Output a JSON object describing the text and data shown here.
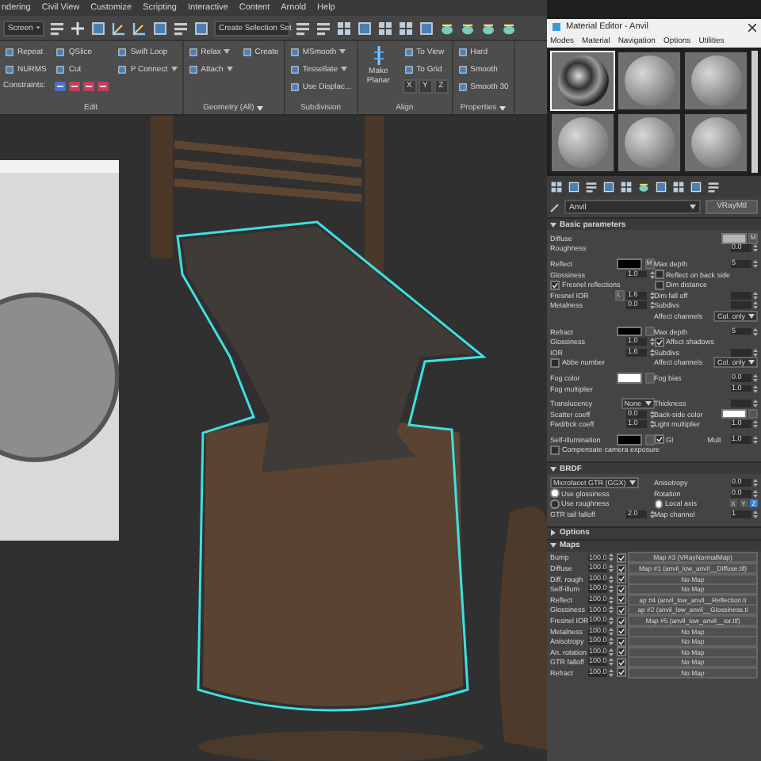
{
  "menu_bar": [
    "ndering",
    "Civil View",
    "Customize",
    "Scripting",
    "Interactive",
    "Content",
    "Arnold",
    "Help"
  ],
  "toolbar": {
    "view_dropdown": "Screen",
    "selection_set": "Create Selection Set"
  },
  "ribbon": {
    "groups": [
      {
        "title": "Edit",
        "dropdown": false,
        "columns": [
          [
            {
              "kind": "button",
              "label": "Repeat"
            },
            {
              "kind": "button",
              "label": "NURMS"
            },
            {
              "kind": "label",
              "label": "Constraints:"
            }
          ],
          [
            {
              "kind": "button",
              "label": "QSlice"
            },
            {
              "kind": "button",
              "label": "Cut"
            },
            {
              "kind": "icons"
            }
          ],
          [
            {
              "kind": "button",
              "label": "Swift Loop"
            },
            {
              "kind": "dropdown",
              "label": "P Connect"
            }
          ]
        ]
      },
      {
        "title": "Geometry (All)",
        "dropdown": true,
        "columns": [
          [
            {
              "kind": "dropdown",
              "label": "Relax"
            },
            {
              "kind": "dropdown",
              "label": "Attach"
            }
          ],
          [
            {
              "kind": "button",
              "label": "Create"
            }
          ]
        ]
      },
      {
        "title": "Subdivision",
        "dropdown": false,
        "columns": [
          [
            {
              "kind": "dropdown",
              "label": "MSmooth"
            },
            {
              "kind": "dropdown",
              "label": "Tessellate"
            },
            {
              "kind": "button",
              "label": "Use Displac..."
            }
          ]
        ]
      },
      {
        "title": "Align",
        "dropdown": false,
        "columns": [
          [
            {
              "kind": "big",
              "label": "Make Planar"
            }
          ],
          [
            {
              "kind": "button",
              "label": "To View"
            },
            {
              "kind": "button",
              "label": "To Grid"
            },
            {
              "kind": "axes",
              "labels": [
                "X",
                "Y",
                "Z"
              ]
            }
          ]
        ]
      },
      {
        "title": "Properties",
        "dropdown": true,
        "columns": [
          [
            {
              "kind": "button",
              "label": "Hard"
            },
            {
              "kind": "button",
              "label": "Smooth"
            },
            {
              "kind": "button",
              "label": "Smooth 30"
            }
          ]
        ]
      }
    ]
  },
  "material_editor": {
    "title": "Material Editor - Anvil",
    "menu": [
      "Modes",
      "Material",
      "Navigation",
      "Options",
      "Utilities"
    ],
    "slots": [
      {
        "kind": "chrome",
        "selected": true
      },
      {
        "kind": "plain",
        "selected": false
      },
      {
        "kind": "plain",
        "selected": false
      },
      {
        "kind": "plain",
        "selected": false
      },
      {
        "kind": "plain",
        "selected": false
      },
      {
        "kind": "plain",
        "selected": false
      }
    ],
    "material_name": "Anvil",
    "material_type": "VRayMtl",
    "rollouts": [
      {
        "title": "Basic parameters",
        "expanded": true,
        "sections": [
          [
            {
              "left": [
                {
                  "kind": "swatch",
                  "label": "Diffuse",
                  "color": "#b4b4b4",
                  "button": "M"
                }
              ]
            },
            {
              "left": [
                {
                  "kind": "spinner",
                  "label": "Roughness",
                  "value": "0.0"
                }
              ]
            }
          ],
          [
            {
              "left": [
                {
                  "kind": "swatch",
                  "label": "Reflect",
                  "color": "#000000",
                  "button": "M"
                }
              ],
              "right": [
                {
                  "kind": "spinner",
                  "label": "Max depth",
                  "value": "5"
                }
              ]
            },
            {
              "left": [
                {
                  "kind": "spinner",
                  "label": "Glossiness",
                  "value": "1.0"
                }
              ],
              "right": [
                {
                  "kind": "check",
                  "label": "Reflect on back side",
                  "checked": false
                }
              ]
            },
            {
              "left": [
                {
                  "kind": "check",
                  "label": "Fresnel reflections",
                  "checked": true
                }
              ],
              "right": [
                {
                  "kind": "check",
                  "label": "Dim distance",
                  "checked": false
                }
              ]
            },
            {
              "left": [
                {
                  "kind": "spinner",
                  "label": "Fresnel IOR",
                  "lock": "L",
                  "value": "1.6"
                }
              ],
              "right": [
                {
                  "kind": "spinner",
                  "label": "Dim fall off"
                }
              ]
            },
            {
              "left": [
                {
                  "kind": "spinner",
                  "label": "Metalness",
                  "value": "0.0"
                }
              ],
              "right": [
                {
                  "kind": "spinner",
                  "label": "Subdivs"
                }
              ]
            },
            {
              "right": [
                {
                  "kind": "dropdown",
                  "label": "Affect channels",
                  "value": "Col. only"
                }
              ]
            }
          ],
          [
            {
              "left": [
                {
                  "kind": "swatch",
                  "label": "Refract",
                  "color": "#000000"
                }
              ],
              "right": [
                {
                  "kind": "spinner",
                  "label": "Max depth",
                  "value": "5"
                }
              ]
            },
            {
              "left": [
                {
                  "kind": "spinner",
                  "label": "Glossiness",
                  "value": "1.0"
                }
              ],
              "right": [
                {
                  "kind": "check",
                  "label": "Affect shadows",
                  "checked": true
                }
              ]
            },
            {
              "left": [
                {
                  "kind": "spinner",
                  "label": "IOR",
                  "value": "1.6"
                }
              ],
              "right": [
                {
                  "kind": "spinner",
                  "label": "Subdivs"
                }
              ]
            },
            {
              "left": [
                {
                  "kind": "check",
                  "label": "Abbe number",
                  "checked": false
                }
              ],
              "right": [
                {
                  "kind": "dropdown",
                  "label": "Affect channels",
                  "value": "Col. only"
                }
              ]
            }
          ],
          [
            {
              "left": [
                {
                  "kind": "swatch",
                  "label": "Fog color",
                  "color": "#ffffff"
                }
              ],
              "right": [
                {
                  "kind": "spinner",
                  "label": "Fog bias",
                  "value": "0.0"
                }
              ]
            },
            {
              "left": [
                {
                  "kind": "spinner",
                  "label": "Fog multiplier",
                  "value": "1.0"
                }
              ]
            }
          ],
          [
            {
              "left": [
                {
                  "kind": "dropdown",
                  "label": "Translucency",
                  "value": "None"
                }
              ],
              "right": [
                {
                  "kind": "spinner",
                  "label": "Thickness"
                }
              ]
            },
            {
              "left": [
                {
                  "kind": "spinner",
                  "label": "Scatter coeff",
                  "value": "0.0"
                }
              ],
              "right": [
                {
                  "kind": "swatch",
                  "label": "Back-side color",
                  "color": "#ffffff"
                }
              ]
            },
            {
              "left": [
                {
                  "kind": "spinner",
                  "label": "Fwd/bck coeff",
                  "value": "1.0"
                }
              ],
              "right": [
                {
                  "kind": "spinner",
                  "label": "Light multiplier",
                  "value": "1.0"
                }
              ]
            }
          ],
          [
            {
              "left": [
                {
                  "kind": "swatch",
                  "label": "Self-illumination",
                  "color": "#000000"
                }
              ],
              "right": [
                {
                  "kind": "check",
                  "label": "GI",
                  "checked": true
                },
                {
                  "kind": "spinner",
                  "label": "Mult",
                  "value": "1.0"
                }
              ]
            },
            {
              "left": [
                {
                  "kind": "check",
                  "label": "Compensate camera exposure",
                  "checked": false
                }
              ]
            }
          ]
        ]
      },
      {
        "title": "BRDF",
        "expanded": true,
        "sections": [
          [
            {
              "left": [
                {
                  "kind": "dropdown",
                  "value": "Microfacet GTR (GGX)"
                }
              ],
              "right": [
                {
                  "kind": "spinner",
                  "label": "Anisotropy",
                  "value": "0.0"
                }
              ]
            },
            {
              "left": [
                {
                  "kind": "radio",
                  "label": "Use glossiness",
                  "selected": true
                }
              ],
              "right": [
                {
                  "kind": "spinner",
                  "label": "Rotation",
                  "value": "0.0"
                }
              ]
            },
            {
              "left": [
                {
                  "kind": "radio",
                  "label": "Use roughness",
                  "selected": false
                }
              ],
              "right": [
                {
                  "kind": "axis",
                  "label": "Local axis",
                  "selected": true,
                  "options": [
                    {
                      "label": "X",
                      "selected": false
                    },
                    {
                      "label": "Y",
                      "selected": false
                    },
                    {
                      "label": "Z",
                      "selected": true
                    }
                  ]
                }
              ]
            },
            {
              "left": [
                {
                  "kind": "spinner",
                  "label": "GTR tail falloff",
                  "value": "2.0"
                }
              ],
              "right": [
                {
                  "kind": "spinner",
                  "label": "Map channel",
                  "value": "1"
                }
              ]
            }
          ]
        ]
      },
      {
        "title": "Options",
        "expanded": false
      },
      {
        "title": "Maps",
        "expanded": true,
        "maps": [
          {
            "label": "Bump",
            "amount": "100.0",
            "on": true,
            "map": "Map #3 (VRayNormalMap)"
          },
          {
            "label": "Diffuse",
            "amount": "100.0",
            "on": true,
            "map": "Map #1 (anvil_low_anvil__Diffuse.tif)"
          },
          {
            "label": "Diff. rough",
            "amount": "100.0",
            "on": true,
            "map": "No Map"
          },
          {
            "label": "Self-illum",
            "amount": "100.0",
            "on": true,
            "map": "No Map"
          },
          {
            "label": "Reflect",
            "amount": "100.0",
            "on": true,
            "map": "ap #4 (anvil_low_anvil__Reflection.ti"
          },
          {
            "label": "Glossiness",
            "amount": "100.0",
            "on": true,
            "map": "ap #2 (anvil_low_anvil__Glossiness.ti"
          },
          {
            "label": "Fresnel IOR",
            "amount": "100.0",
            "on": true,
            "map": "Map #5 (anvil_low_anvil__ior.tif)"
          },
          {
            "label": "Metalness",
            "amount": "100.0",
            "on": true,
            "map": "No Map"
          },
          {
            "label": "Anisotropy",
            "amount": "100.0",
            "on": true,
            "map": "No Map"
          },
          {
            "label": "An. rotation",
            "amount": "100.0",
            "on": true,
            "map": "No Map"
          },
          {
            "label": "GTR falloff",
            "amount": "100.0",
            "on": true,
            "map": "No Map"
          },
          {
            "label": "Refract",
            "amount": "100.0",
            "on": true,
            "map": "No Map"
          }
        ]
      }
    ]
  }
}
